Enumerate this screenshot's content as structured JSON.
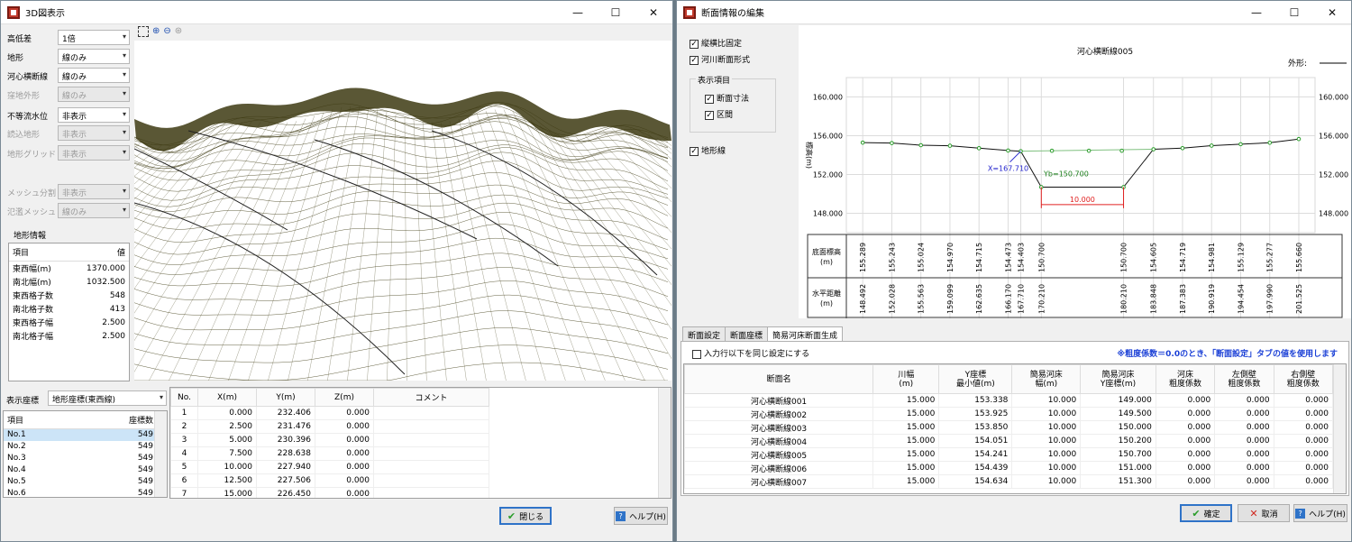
{
  "w1": {
    "title": "3D図表示",
    "controls": [
      {
        "label": "高低差",
        "value": "1倍",
        "disabled": false
      },
      {
        "label": "地形",
        "value": "線のみ",
        "disabled": false
      },
      {
        "label": "河心横断線",
        "value": "線のみ",
        "disabled": false
      },
      {
        "label": "窪地外形",
        "value": "線のみ",
        "disabled": true
      },
      {
        "label": "不等流水位",
        "value": "非表示",
        "disabled": false
      },
      {
        "label": "読込地形",
        "value": "非表示",
        "disabled": true
      },
      {
        "label": "地形グリッド",
        "value": "非表示",
        "disabled": true
      },
      {
        "label": "メッシュ分割",
        "value": "非表示",
        "disabled": true
      },
      {
        "label": "氾濫メッシュ",
        "value": "線のみ",
        "disabled": true
      }
    ],
    "terrain_info_title": "地形情報",
    "terrain_info_headers": [
      "項目",
      "値"
    ],
    "terrain_info_rows": [
      [
        "東西幅(m)",
        "1370.000"
      ],
      [
        "南北幅(m)",
        "1032.500"
      ],
      [
        "東西格子数",
        "548"
      ],
      [
        "南北格子数",
        "413"
      ],
      [
        "東西格子幅",
        "2.500"
      ],
      [
        "南北格子幅",
        "2.500"
      ]
    ],
    "coord_label": "表示座標",
    "coord_value": "地形座標(東西線)",
    "item_headers": [
      "項目",
      "座標数"
    ],
    "item_rows": [
      [
        "No.1",
        "549"
      ],
      [
        "No.2",
        "549"
      ],
      [
        "No.3",
        "549"
      ],
      [
        "No.4",
        "549"
      ],
      [
        "No.5",
        "549"
      ],
      [
        "No.6",
        "549"
      ]
    ],
    "coord_headers": [
      "No.",
      "X(m)",
      "Y(m)",
      "Z(m)",
      "コメント"
    ],
    "coord_rows": [
      [
        "1",
        "0.000",
        "232.406",
        "0.000",
        ""
      ],
      [
        "2",
        "2.500",
        "231.476",
        "0.000",
        ""
      ],
      [
        "3",
        "5.000",
        "230.396",
        "0.000",
        ""
      ],
      [
        "4",
        "7.500",
        "228.638",
        "0.000",
        ""
      ],
      [
        "5",
        "10.000",
        "227.940",
        "0.000",
        ""
      ],
      [
        "6",
        "12.500",
        "227.506",
        "0.000",
        ""
      ],
      [
        "7",
        "15.000",
        "226.450",
        "0.000",
        ""
      ]
    ],
    "close_label": "閉じる",
    "help_label": "ヘルプ(H)",
    "terrain_color": "#3d3a12"
  },
  "w2": {
    "title": "断面情報の編集",
    "checks": [
      {
        "label": "縦横比固定",
        "checked": true
      },
      {
        "label": "河川断面形式",
        "checked": true
      }
    ],
    "group_title": "表示項目",
    "group_checks": [
      {
        "label": "断面寸法",
        "checked": true
      },
      {
        "label": "区間",
        "checked": true
      }
    ],
    "terrain_check": {
      "label": "地形線",
      "checked": true
    },
    "chart_title": "河心横断線005",
    "outline_label": "外形:",
    "y_ticks": [
      "160.000",
      "156.000",
      "152.000",
      "148.000"
    ],
    "ylabel": "標高(m)",
    "annot_x": "X=167.710",
    "annot_yb": "Yb=150.700",
    "annot_width": "10.000",
    "row1_label": "底面標高\n(m)",
    "row2_label": "水平距離\n(m)",
    "elev_values": [
      "155.289",
      "155.243",
      "155.024",
      "154.970",
      "154.715",
      "154.473",
      "154.403",
      "150.700",
      "150.700",
      "154.605",
      "154.719",
      "154.981",
      "155.129",
      "155.277",
      "155.660"
    ],
    "dist_values": [
      "148.492",
      "152.028",
      "155.563",
      "159.099",
      "162.635",
      "166.170",
      "167.710",
      "170.210",
      "180.210",
      "183.848",
      "187.383",
      "190.919",
      "194.454",
      "197.990",
      "201.525"
    ],
    "tabs": [
      "断面設定",
      "断面座標",
      "簡易河床断面生成"
    ],
    "same_settings": "入力行以下を同じ設定にする",
    "note": "※粗度係数＝0.0のとき、「断面設定」タブの値を使用します",
    "table_headers": [
      "断面名",
      "川幅\n(m)",
      "Y座標\n最小値(m)",
      "簡易河床\n幅(m)",
      "簡易河床\nY座標(m)",
      "河床\n粗度係数",
      "左側壁\n粗度係数",
      "右側壁\n粗度係数"
    ],
    "table_rows": [
      [
        "河心横断線001",
        "15.000",
        "153.338",
        "10.000",
        "149.000",
        "0.000",
        "0.000",
        "0.000"
      ],
      [
        "河心横断線002",
        "15.000",
        "153.925",
        "10.000",
        "149.500",
        "0.000",
        "0.000",
        "0.000"
      ],
      [
        "河心横断線003",
        "15.000",
        "153.850",
        "10.000",
        "150.000",
        "0.000",
        "0.000",
        "0.000"
      ],
      [
        "河心横断線004",
        "15.000",
        "154.051",
        "10.000",
        "150.200",
        "0.000",
        "0.000",
        "0.000"
      ],
      [
        "河心横断線005",
        "15.000",
        "154.241",
        "10.000",
        "150.700",
        "0.000",
        "0.000",
        "0.000"
      ],
      [
        "河心横断線006",
        "15.000",
        "154.439",
        "10.000",
        "151.000",
        "0.000",
        "0.000",
        "0.000"
      ],
      [
        "河心横断線007",
        "15.000",
        "154.634",
        "10.000",
        "151.300",
        "0.000",
        "0.000",
        "0.000"
      ]
    ],
    "ok_label": "確定",
    "cancel_label": "取消",
    "help_label": "ヘルプ(H)"
  }
}
